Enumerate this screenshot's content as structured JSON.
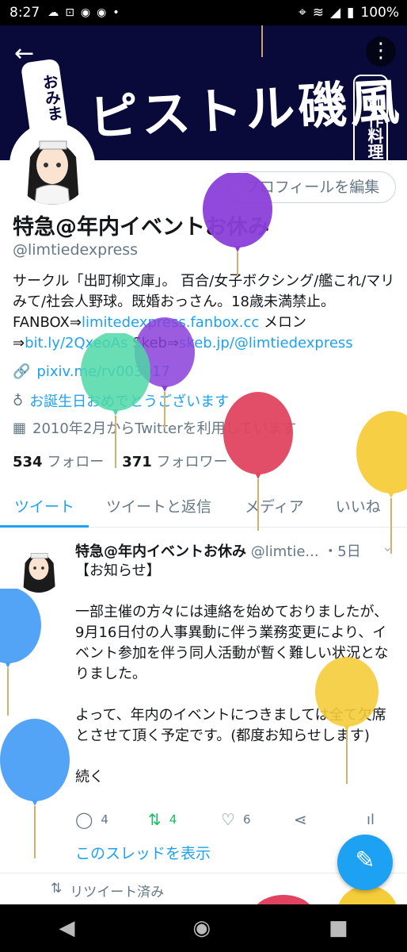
{
  "status_bar": {
    "time": "8:27",
    "battery": "100%",
    "left_icons": [
      "cloud-icon",
      "voicemail-icon",
      "circle-icon",
      "circle-icon",
      "dot-icon"
    ],
    "right_icons": [
      "location-icon",
      "wifi-icon",
      "signal-icon",
      "battery-icon"
    ]
  },
  "banner": {
    "title": "ピストル磯風",
    "left_tag": "おみまいする",
    "right_tag": "創作料理"
  },
  "profile": {
    "edit_button": "プロフィールを編集",
    "name": "特急@年内イベントお休み",
    "handle": "@limtiedexpress",
    "bio_text_1": "サークル「出町柳文庫」。 百合/女子ボクシング/艦これ/マリみて/社会人野球。既婚おっさん。18歳未満禁止。 FANBOX⇒",
    "bio_link_1": "limitedexpress.fanbox.cc",
    "bio_text_2": " メロン⇒",
    "bio_link_2": "bit.ly/2QxeoAs",
    "bio_text_3": " Skeb⇒",
    "bio_link_3": "skeb.jp/@limtiedexpress",
    "website": "pixiv.me/rv003917",
    "birthday": "お誕生日おめでとうございます",
    "joined": "2010年2月からTwitterを利用しています",
    "following_count": "534",
    "following_label": "フォロー",
    "followers_count": "371",
    "followers_label": "フォロワー"
  },
  "tabs": [
    "ツイート",
    "ツイートと返信",
    "メディア",
    "いいね"
  ],
  "tweet": {
    "author": "特急@年内イベントお休み",
    "handle": "@limtie...",
    "time": "・5日",
    "body": "【お知らせ】\n\n一部主催の方々には連絡を始めておりましたが、9月16日付の人事異動に伴う業務変更により、イベント参加を伴う同人活動が暫く難しい状況となりました。\n\nよって、年内のイベントにつきましては全て欠席とさせて頂く予定です。(都度お知らせします)\n\n続く",
    "replies": "4",
    "retweets": "4",
    "likes": "6",
    "show_thread": "このスレッドを表示"
  },
  "retweeted_label": "リツイート済み",
  "colors": {
    "accent": "#1da1f2",
    "retweet": "#17bf63",
    "banner_bg": "#0a0a3a"
  }
}
